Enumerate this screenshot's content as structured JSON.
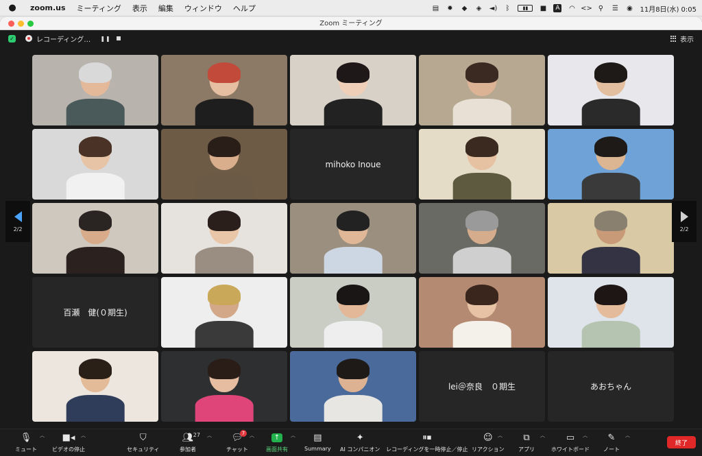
{
  "menubar": {
    "app": "zoom.us",
    "items": [
      "ミーティング",
      "表示",
      "編集",
      "ウィンドウ",
      "ヘルプ"
    ],
    "clock": "11月8日(水) 0:05",
    "input_letter": "A"
  },
  "window": {
    "title": "Zoom ミーティング"
  },
  "infobar": {
    "recording_label": "レコーディング…",
    "pause": "❚❚",
    "view_label": "表示"
  },
  "nav": {
    "left_page": "2/2",
    "right_page": "2/2"
  },
  "tiles": [
    {
      "type": "video",
      "bg": "#b9b3ad",
      "skin": "#e3b99a",
      "hair": "#d9d9d9",
      "shirt": "#4a5a5a"
    },
    {
      "type": "video",
      "bg": "#8c7a66",
      "skin": "#e6bfa2",
      "hair": "#c24a3b",
      "shirt": "#1e1e1e"
    },
    {
      "type": "video",
      "bg": "#d8d1c8",
      "skin": "#efcfb8",
      "hair": "#1e1818",
      "shirt": "#222"
    },
    {
      "type": "video",
      "bg": "#b7a892",
      "skin": "#ddb395",
      "hair": "#3a2a22",
      "shirt": "#e8e0d5"
    },
    {
      "type": "video",
      "bg": "#e8e8ec",
      "skin": "#e3bfa0",
      "hair": "#1e1a18",
      "shirt": "#2a2a2a"
    },
    {
      "type": "video",
      "bg": "#d9d9da",
      "skin": "#e8c4a6",
      "hair": "#4a3326",
      "shirt": "#f1f1f1"
    },
    {
      "type": "video",
      "bg": "#6d5b45",
      "skin": "#d9ae8c",
      "hair": "#2a1e18",
      "shirt": "#6b5a45"
    },
    {
      "type": "name",
      "name": "mihoko Inoue"
    },
    {
      "type": "video",
      "bg": "#e4dcc6",
      "skin": "#e6c2a3",
      "hair": "#3a2a1f",
      "shirt": "#5e5a3f"
    },
    {
      "type": "video",
      "bg": "#6fa3d8",
      "skin": "#dcb593",
      "hair": "#1e1a18",
      "shirt": "#3a3a3a"
    },
    {
      "type": "video",
      "bg": "#cfc8bf",
      "skin": "#d8ac8a",
      "hair": "#2a2523",
      "shirt": "#2b2220"
    },
    {
      "type": "video",
      "bg": "#e6e3de",
      "skin": "#e9c6a8",
      "hair": "#2a1f1a",
      "shirt": "#9a8e82"
    },
    {
      "type": "video",
      "bg": "#9b8f7f",
      "skin": "#e0b898",
      "hair": "#222",
      "shirt": "#cdd7e3"
    },
    {
      "type": "video",
      "bg": "#6a6a64",
      "skin": "#d6ad8c",
      "hair": "#9a9a9a",
      "shirt": "#cfcfcf"
    },
    {
      "type": "video",
      "bg": "#d9c9a4",
      "skin": "#c99a78",
      "hair": "#8a8070",
      "shirt": "#334"
    },
    {
      "type": "name",
      "name": "百瀬　健(０期生)"
    },
    {
      "type": "video",
      "bg": "#eeeeee",
      "skin": "#d3a888",
      "hair": "#c9a85a",
      "shirt": "#3a3a3a"
    },
    {
      "type": "video",
      "bg": "#c9cdc4",
      "skin": "#e2b898",
      "hair": "#1a1616",
      "shirt": "#eeeeee"
    },
    {
      "type": "video",
      "bg": "#b58a72",
      "skin": "#e8c2a4",
      "hair": "#3a261d",
      "shirt": "#f4f0ea"
    },
    {
      "type": "video",
      "bg": "#dfe3ea",
      "skin": "#e4bc9c",
      "hair": "#1d1614",
      "shirt": "#b5c4b0"
    },
    {
      "type": "video",
      "bg": "#ece6df",
      "skin": "#e4bb98",
      "hair": "#2a2018",
      "shirt": "#2f3d5a"
    },
    {
      "type": "video",
      "bg": "#2e2f30",
      "skin": "#e6bda0",
      "hair": "#2a1d18",
      "shirt": "#e0457a"
    },
    {
      "type": "video",
      "bg": "#496a9a",
      "skin": "#dcb292",
      "hair": "#1e1a18",
      "shirt": "#e8e6e2"
    },
    {
      "type": "name",
      "name": "lei＠奈良　０期生"
    },
    {
      "type": "name",
      "name": "あおちゃん"
    }
  ],
  "toolbar": {
    "mute": "ミュート",
    "video": "ビデオの停止",
    "security": "セキュリティ",
    "participants": "参加者",
    "participants_count": "27",
    "chat": "チャット",
    "chat_badge": "7",
    "share": "画面共有",
    "summary": "Summary",
    "ai": "AI コンパニオン",
    "recording": "レコーディングを一時停止／停止",
    "reactions": "リアクション",
    "apps": "アプリ",
    "whiteboard": "ホワイトボード",
    "notes": "ノート",
    "end": "終了"
  },
  "colors": {
    "accent_blue": "#4aa3ff",
    "share_green": "#22b14c",
    "end_red": "#e02828",
    "rec_red": "#e23b3b"
  }
}
